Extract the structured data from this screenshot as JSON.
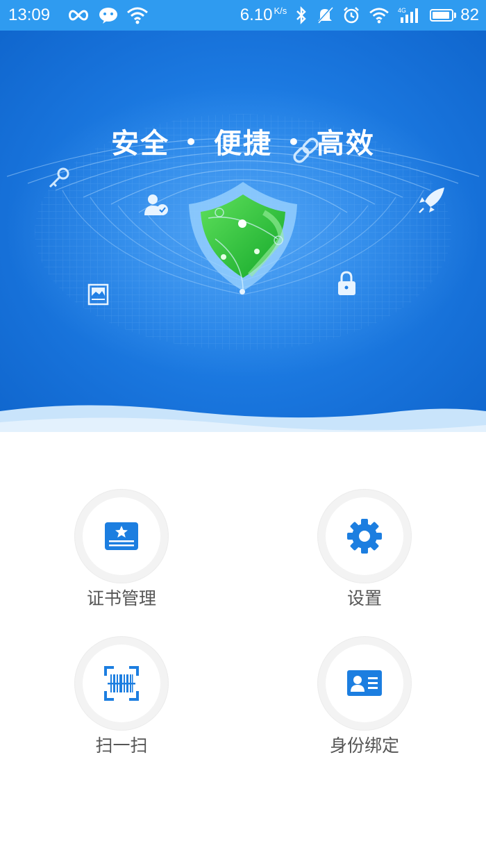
{
  "status_bar": {
    "time": "13:09",
    "net_speed": "6.10",
    "net_speed_unit": "K/s",
    "battery": "82",
    "left_icons": [
      "infinity-icon",
      "wechat-icon",
      "wifi-icon"
    ],
    "right_icons": [
      "bluetooth-icon",
      "mute-bell-icon",
      "alarm-icon",
      "wifi-icon",
      "signal-4g-icon",
      "battery-icon"
    ]
  },
  "hero": {
    "slogan_words": [
      "安全",
      "便捷",
      "高效"
    ],
    "slogan_separator": "•",
    "accent_color": "#1f7fe6",
    "shield_color": "#2ec33a",
    "decor_icons": [
      "key-icon",
      "user-check-icon",
      "image-card-icon",
      "link-icon",
      "rocket-icon",
      "lock-icon",
      "shield-icon"
    ]
  },
  "menu": {
    "items": [
      {
        "label": "证书管理",
        "icon": "certificate-icon"
      },
      {
        "label": "设置",
        "icon": "gear-icon"
      },
      {
        "label": "扫一扫",
        "icon": "barcode-scan-icon"
      },
      {
        "label": "身份绑定",
        "icon": "id-card-icon"
      }
    ],
    "icon_color": "#1c7ee0"
  }
}
